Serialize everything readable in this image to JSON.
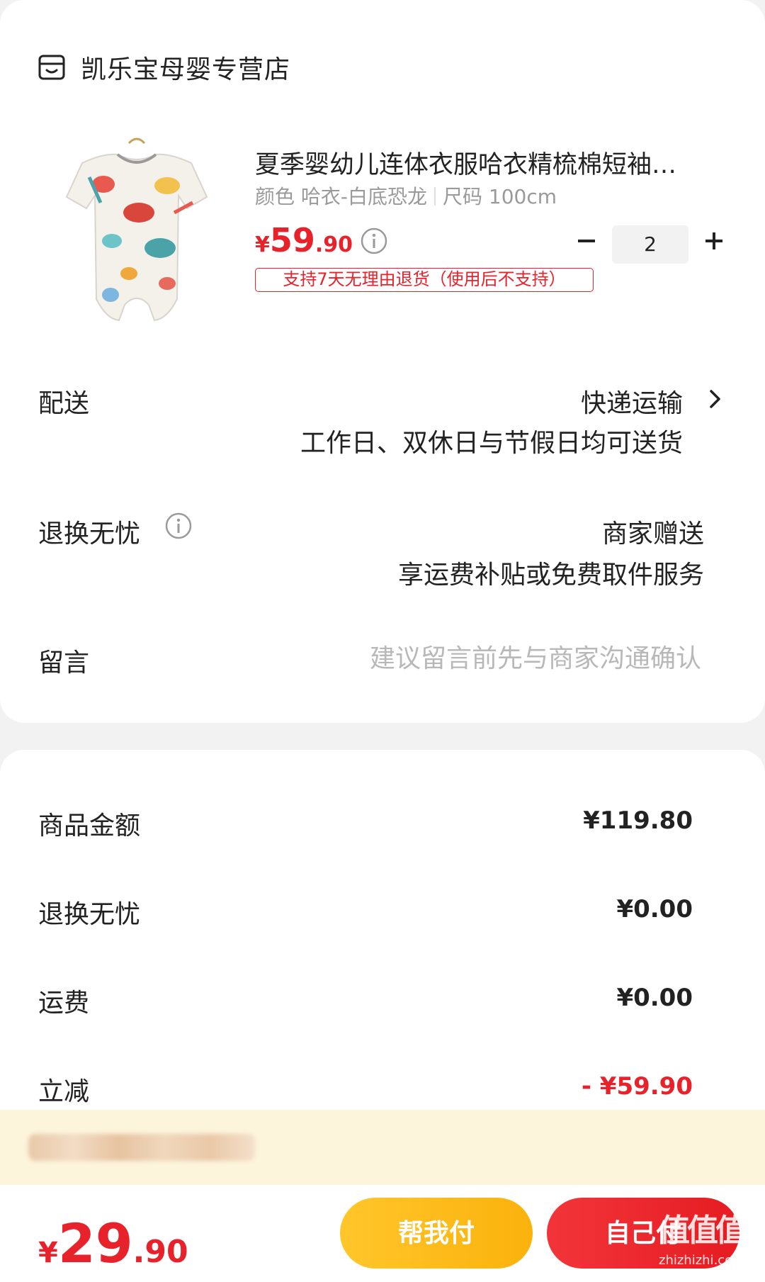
{
  "store": {
    "name": "凯乐宝母婴专营店"
  },
  "product": {
    "title": "夏季婴幼儿连体衣服哈衣精梳棉短袖…",
    "spec_color": "颜色 哈衣-白底恐龙",
    "spec_size": "尺码 100cm",
    "price_yen": "¥",
    "price_int": "59",
    "price_dec": ".90",
    "return_tag": "支持7天无理由退货（使用后不支持）",
    "quantity": "2"
  },
  "delivery": {
    "label": "配送",
    "method": "快递运输",
    "days": "工作日、双休日与节假日均可送货"
  },
  "returns": {
    "label": "退换无忧",
    "gift": "商家赠送",
    "service": "享运费补贴或免费取件服务"
  },
  "note": {
    "label": "留言",
    "placeholder": "建议留言前先与商家沟通确认"
  },
  "summary": {
    "goods_label": "商品金额",
    "goods_value": "¥119.80",
    "returns_label": "退换无忧",
    "returns_value": "¥0.00",
    "shipping_label": "运费",
    "shipping_value": "¥0.00",
    "discount_label": "立减",
    "discount_value": "- ¥59.90"
  },
  "bottom": {
    "total_yen": "¥",
    "total_int": "29",
    "total_dec": ".90",
    "help_pay_label": "帮我付",
    "self_pay_label": "自己付",
    "watermark_mark": "值值值",
    "watermark_url": "zhizhizhi.com"
  },
  "colors": {
    "accent_red": "#e8222a",
    "help_button": "#fbb20c",
    "promo_bg": "#fdf4dc"
  }
}
